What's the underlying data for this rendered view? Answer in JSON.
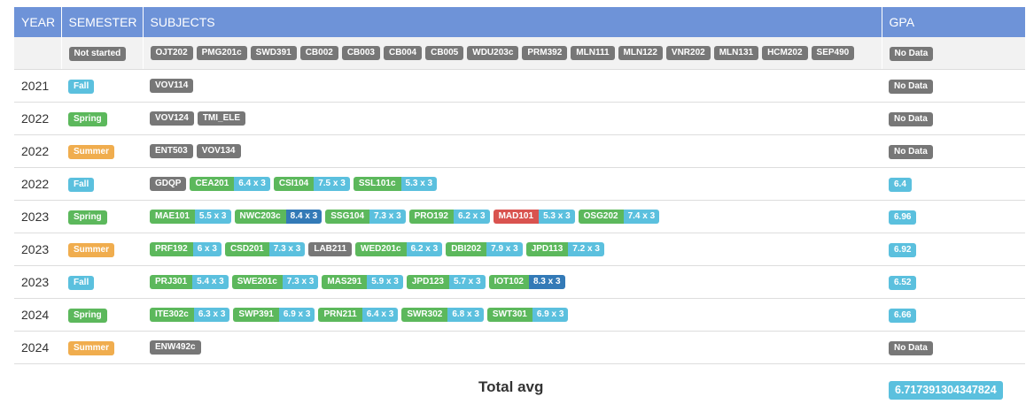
{
  "headers": {
    "year": "YEAR",
    "semester": "SEMESTER",
    "subjects": "SUBJECTS",
    "gpa": "GPA"
  },
  "colors": {
    "header": "#6e93d8",
    "default": "#777777",
    "info": "#5bc0de",
    "success": "#5cb85c",
    "warning": "#f0ad4e",
    "danger": "#d9534f",
    "primary": "#337ab7"
  },
  "rows": [
    {
      "year": "",
      "semester": "Not started",
      "semester_style": "default",
      "subjects": [
        {
          "code": "OJT202"
        },
        {
          "code": "PMG201c"
        },
        {
          "code": "SWD391"
        },
        {
          "code": "CB002"
        },
        {
          "code": "CB003"
        },
        {
          "code": "CB004"
        },
        {
          "code": "CB005"
        },
        {
          "code": "WDU203c"
        },
        {
          "code": "PRM392"
        },
        {
          "code": "MLN111"
        },
        {
          "code": "MLN122"
        },
        {
          "code": "VNR202"
        },
        {
          "code": "MLN131"
        },
        {
          "code": "HCM202"
        },
        {
          "code": "SEP490"
        }
      ],
      "gpa": "No Data",
      "gpa_style": "default"
    },
    {
      "year": "2021",
      "semester": "Fall",
      "semester_style": "info",
      "subjects": [
        {
          "code": "VOV114"
        }
      ],
      "gpa": "No Data",
      "gpa_style": "default"
    },
    {
      "year": "2022",
      "semester": "Spring",
      "semester_style": "success",
      "subjects": [
        {
          "code": "VOV124"
        },
        {
          "code": "TMI_ELE"
        }
      ],
      "gpa": "No Data",
      "gpa_style": "default"
    },
    {
      "year": "2022",
      "semester": "Summer",
      "semester_style": "warning",
      "subjects": [
        {
          "code": "ENT503"
        },
        {
          "code": "VOV134"
        }
      ],
      "gpa": "No Data",
      "gpa_style": "default"
    },
    {
      "year": "2022",
      "semester": "Fall",
      "semester_style": "info",
      "subjects": [
        {
          "code": "GDQP"
        },
        {
          "code": "CEA201",
          "score": "6.4 x 3",
          "code_style": "success",
          "score_style": "info"
        },
        {
          "code": "CSI104",
          "score": "7.5 x 3",
          "code_style": "success",
          "score_style": "info"
        },
        {
          "code": "SSL101c",
          "score": "5.3 x 3",
          "code_style": "success",
          "score_style": "info"
        }
      ],
      "gpa": "6.4",
      "gpa_style": "info"
    },
    {
      "year": "2023",
      "semester": "Spring",
      "semester_style": "success",
      "subjects": [
        {
          "code": "MAE101",
          "score": "5.5 x 3",
          "code_style": "success",
          "score_style": "info"
        },
        {
          "code": "NWC203c",
          "score": "8.4 x 3",
          "code_style": "success",
          "score_style": "primary"
        },
        {
          "code": "SSG104",
          "score": "7.3 x 3",
          "code_style": "success",
          "score_style": "info"
        },
        {
          "code": "PRO192",
          "score": "6.2 x 3",
          "code_style": "success",
          "score_style": "info"
        },
        {
          "code": "MAD101",
          "score": "5.3 x 3",
          "code_style": "danger",
          "score_style": "info"
        },
        {
          "code": "OSG202",
          "score": "7.4 x 3",
          "code_style": "success",
          "score_style": "info"
        }
      ],
      "gpa": "6.96",
      "gpa_style": "info"
    },
    {
      "year": "2023",
      "semester": "Summer",
      "semester_style": "warning",
      "subjects": [
        {
          "code": "PRF192",
          "score": "6 x 3",
          "code_style": "success",
          "score_style": "info"
        },
        {
          "code": "CSD201",
          "score": "7.3 x 3",
          "code_style": "success",
          "score_style": "info"
        },
        {
          "code": "LAB211"
        },
        {
          "code": "WED201c",
          "score": "6.2 x 3",
          "code_style": "success",
          "score_style": "info"
        },
        {
          "code": "DBI202",
          "score": "7.9 x 3",
          "code_style": "success",
          "score_style": "info"
        },
        {
          "code": "JPD113",
          "score": "7.2 x 3",
          "code_style": "success",
          "score_style": "info"
        }
      ],
      "gpa": "6.92",
      "gpa_style": "info"
    },
    {
      "year": "2023",
      "semester": "Fall",
      "semester_style": "info",
      "subjects": [
        {
          "code": "PRJ301",
          "score": "5.4 x 3",
          "code_style": "success",
          "score_style": "info"
        },
        {
          "code": "SWE201c",
          "score": "7.3 x 3",
          "code_style": "success",
          "score_style": "info"
        },
        {
          "code": "MAS291",
          "score": "5.9 x 3",
          "code_style": "success",
          "score_style": "info"
        },
        {
          "code": "JPD123",
          "score": "5.7 x 3",
          "code_style": "success",
          "score_style": "info"
        },
        {
          "code": "IOT102",
          "score": "8.3 x 3",
          "code_style": "success",
          "score_style": "primary"
        }
      ],
      "gpa": "6.52",
      "gpa_style": "info"
    },
    {
      "year": "2024",
      "semester": "Spring",
      "semester_style": "success",
      "subjects": [
        {
          "code": "ITE302c",
          "score": "6.3 x 3",
          "code_style": "success",
          "score_style": "info"
        },
        {
          "code": "SWP391",
          "score": "6.9 x 3",
          "code_style": "success",
          "score_style": "info"
        },
        {
          "code": "PRN211",
          "score": "6.4 x 3",
          "code_style": "success",
          "score_style": "info"
        },
        {
          "code": "SWR302",
          "score": "6.8 x 3",
          "code_style": "success",
          "score_style": "info"
        },
        {
          "code": "SWT301",
          "score": "6.9 x 3",
          "code_style": "success",
          "score_style": "info"
        }
      ],
      "gpa": "6.66",
      "gpa_style": "info"
    },
    {
      "year": "2024",
      "semester": "Summer",
      "semester_style": "warning",
      "subjects": [
        {
          "code": "ENW492c"
        }
      ],
      "gpa": "No Data",
      "gpa_style": "default"
    }
  ],
  "footer": {
    "label": "Total avg",
    "value": "6.717391304347824"
  }
}
